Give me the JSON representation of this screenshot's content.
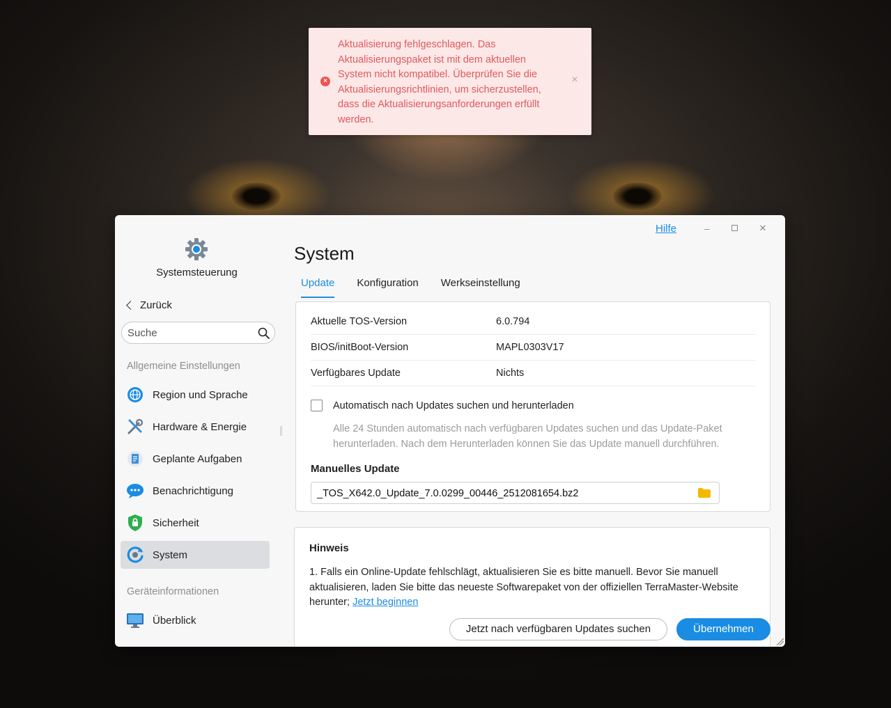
{
  "toast": {
    "message": "Aktualisierung fehlgeschlagen. Das Aktualisierungspaket ist mit dem aktuellen System nicht kompatibel. Überprüfen Sie die Aktualisierungsrichtlinien, um sicherzustellen, dass die Aktualisierungsanforderungen erfüllt werden.",
    "icon": "error-icon",
    "close_glyph": "×",
    "color": "#e0595c"
  },
  "window": {
    "help_label": "Hilfe",
    "minimize_glyph": "–",
    "maximize_glyph": "☐",
    "close_glyph": "✕"
  },
  "sidebar": {
    "app_title": "Systemsteuerung",
    "back_label": "Zurück",
    "search_placeholder": "Suche",
    "section_general": "Allgemeine Einstellungen",
    "section_device": "Geräteinformationen",
    "items": [
      {
        "label": "Region und Sprache",
        "icon": "globe-icon"
      },
      {
        "label": "Hardware & Energie",
        "icon": "tools-icon"
      },
      {
        "label": "Geplante Aufgaben",
        "icon": "tasks-icon"
      },
      {
        "label": "Benachrichtigung",
        "icon": "chat-bubble-icon"
      },
      {
        "label": "Sicherheit",
        "icon": "shield-icon"
      },
      {
        "label": "System",
        "icon": "system-update-icon",
        "active": true
      },
      {
        "label": "Überblick",
        "icon": "monitor-icon"
      }
    ]
  },
  "main": {
    "title": "System",
    "tabs": [
      "Update",
      "Konfiguration",
      "Werkseinstellung"
    ],
    "active_tab": "Update",
    "info": [
      {
        "key": "Aktuelle TOS-Version",
        "value": "6.0.794"
      },
      {
        "key": "BIOS/initBoot-Version",
        "value": "MAPL0303V17"
      },
      {
        "key": "Verfügbares Update",
        "value": "Nichts"
      }
    ],
    "auto_update_label": "Automatisch nach Updates suchen und herunterladen",
    "auto_update_checked": false,
    "auto_update_hint": "Alle 24 Stunden automatisch nach verfügbaren Updates suchen und das Update-Paket herunterladen. Nach dem Herunterladen können Sie das Update manuell durchführen.",
    "manual_update_title": "Manuelles Update",
    "manual_update_file": "_TOS_X642.0_Update_7.0.0299_00446_2512081654.bz2",
    "note_title": "Hinweis",
    "note_text": "1. Falls ein Online-Update fehlschlägt, aktualisieren Sie es bitte manuell. Bevor Sie manuell aktualisieren, laden Sie bitte das neueste Softwarepaket von der offiziellen TerraMaster-Website herunter; ",
    "note_link": "Jetzt beginnen"
  },
  "footer": {
    "check_updates_label": "Jetzt nach verfügbaren Updates suchen",
    "apply_label": "Übernehmen"
  },
  "colors": {
    "accent": "#1b8ce3",
    "error": "#ef5350"
  }
}
